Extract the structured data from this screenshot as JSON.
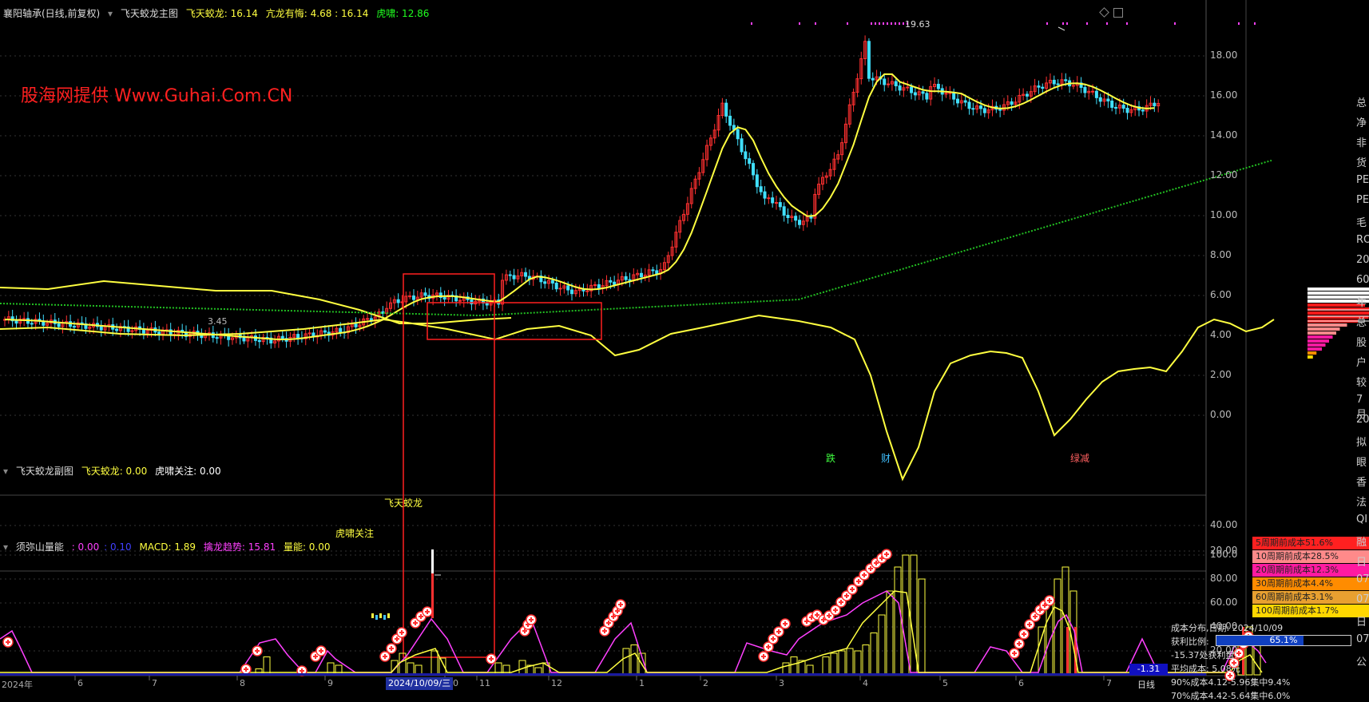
{
  "main_header": {
    "stock": "襄阳轴承(日线,前复权)",
    "indicator": "飞天蛟龙主图",
    "fly_label": "飞天蛟龙: 16.14",
    "kang_label": "亢龙有悔: 4.68 : 16.14",
    "tiger_label": "虎啸: 12.86"
  },
  "watermark": "股海网提供 Www.Guhai.Com.CN",
  "price_annotations": {
    "high": "19.63",
    "low": "3.45"
  },
  "main_yaxis": [
    "18.00",
    "16.00",
    "14.00",
    "12.00",
    "10.00",
    "8.00",
    "6.00",
    "4.00",
    "2.00",
    "0.00"
  ],
  "signals": [
    "跌",
    "财",
    "绿减"
  ],
  "sub_header": {
    "title": "飞天蛟龙副图",
    "fly_label": "飞天蛟龙: 0.00",
    "tiger_label": "虎啸关注: 0.00"
  },
  "sub_annotations": {
    "fly": "飞天蛟龙",
    "tiger": "虎啸关注"
  },
  "sub_yaxis": [
    "40.00",
    "20.00"
  ],
  "vol_header": {
    "title": "须弥山量能",
    "v1": ": 0.00",
    "v2": ": 0.10",
    "macd": "MACD: 1.89",
    "trend": "擒龙趋势: 15.81",
    "energy": "量能: 0.00"
  },
  "vol_yaxis": [
    "100.0",
    "80.00",
    "60.00",
    "40.00",
    "20.00"
  ],
  "vol_current": "-1.31",
  "xaxis": {
    "labels": [
      "2024年",
      "6",
      "7",
      "8",
      "9",
      "10",
      "11",
      "12",
      "1",
      "2",
      "3",
      "4",
      "5",
      "6",
      "7"
    ],
    "cursor_date": "2024/10/09/三",
    "period": "日线"
  },
  "cost_legend": [
    {
      "label": "5周期前成本51.6%",
      "color": "#ff2020"
    },
    {
      "label": "10周期前成本28.5%",
      "color": "#ff8a8a"
    },
    {
      "label": "20周期前成本12.3%",
      "color": "#ff1aa0"
    },
    {
      "label": "30周期前成本4.4%",
      "color": "#ff8c00"
    },
    {
      "label": "60周期前成本3.1%",
      "color": "#e8a030"
    },
    {
      "label": "100周期前成本1.7%",
      "color": "#ffd700"
    }
  ],
  "cost_info": {
    "date_line": "成本分布,日期: 2024/10/09",
    "profit_label": "获利比例:",
    "profit_value": "65.1%",
    "profit_fraction": 0.651,
    "curve_line": "-15.37处获利盘:",
    "avg_cost": "平均成本: 5.08元",
    "c90": "90%成本4.12-5.96集中9.4%",
    "c70": "70%成本4.42-5.64集中6.0%"
  },
  "right_edge_glyphs": [
    "总",
    "净",
    "非",
    "货",
    "PE",
    "PE",
    "毛",
    "RO",
    "20",
    "60",
    "年",
    "总",
    "股",
    "户",
    "较",
    "7月",
    "20",
    "拟",
    "眼",
    "香",
    "法",
    "QI",
    "融",
    "日",
    "07",
    "07",
    "日",
    "07",
    "公"
  ],
  "colors": {
    "up": "#ff3030",
    "down": "#40e0ff",
    "ma": "#ffff40",
    "slow_ma": "#22c022",
    "purple": "#ff40ff",
    "frame": "#ff2020"
  }
}
